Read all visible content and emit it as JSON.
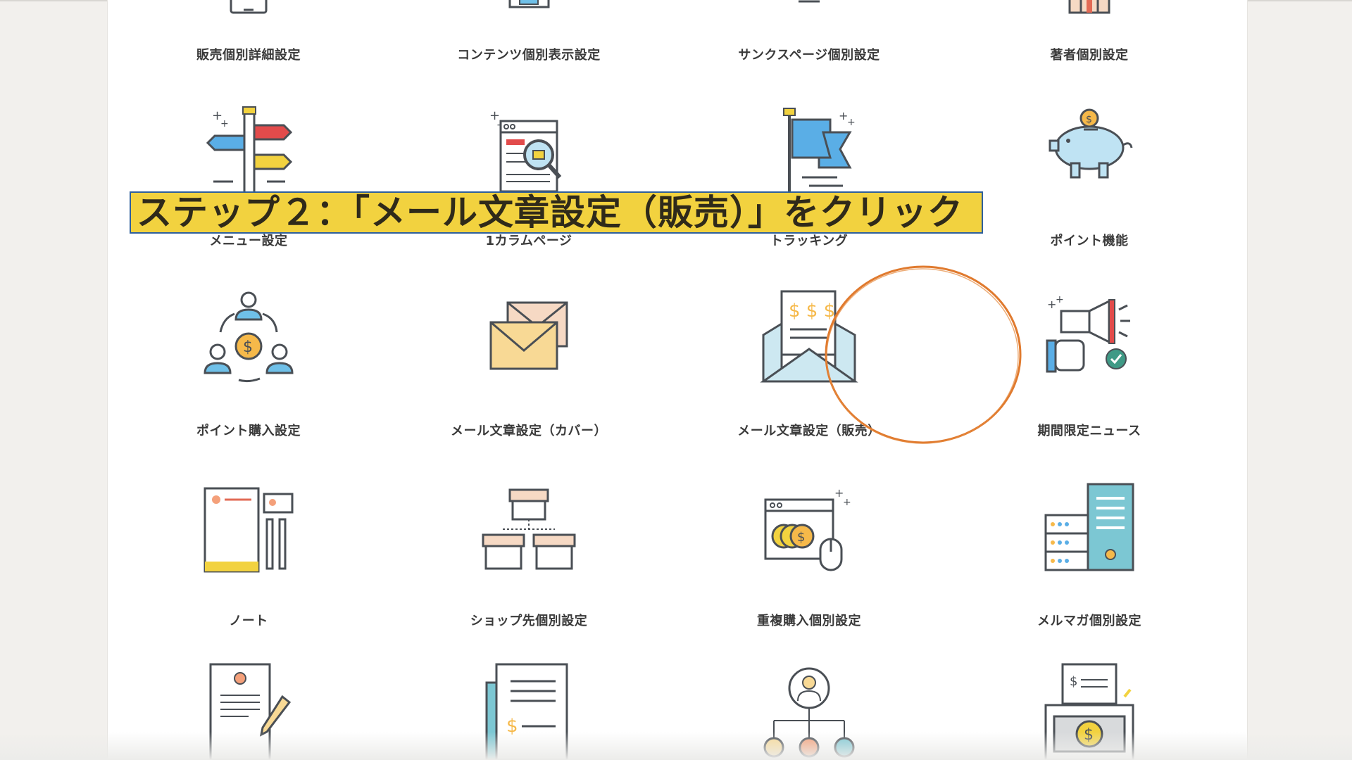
{
  "banner": {
    "text": "ステップ２：「メール文章設定（販売）」をクリック"
  },
  "settings": {
    "row1": [
      "販売個別詳細設定",
      "コンテンツ個別表示設定",
      "サンクスページ個別設定",
      "著者個別設定"
    ],
    "row2": [
      "メニュー設定",
      "1カラムページ",
      "トラッキング",
      "ポイント機能"
    ],
    "row3": [
      "ポイント購入設定",
      "メール文章設定（カバー）",
      "メール文章設定（販売）",
      "期間限定ニュース"
    ],
    "row4": [
      "ノート",
      "ショップ先個別設定",
      "重複購入個別設定",
      "メルマガ個別設定"
    ]
  },
  "colors": {
    "banner_bg": "#f2d23f",
    "banner_border": "#2e5f9c",
    "highlight_circle": "#e07a2e"
  }
}
